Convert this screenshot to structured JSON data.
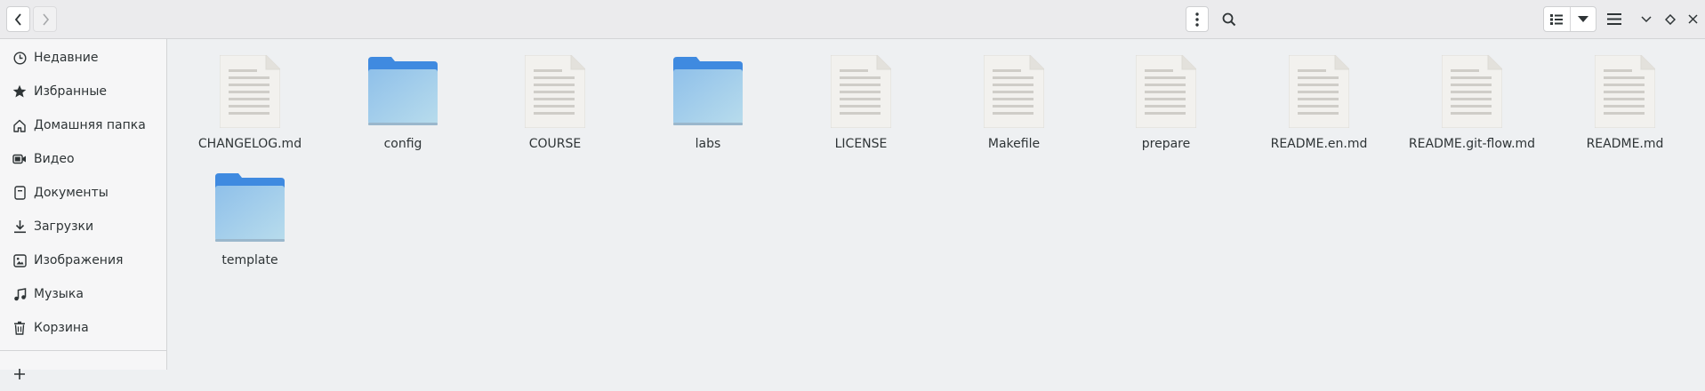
{
  "header": {
    "back_icon": "chevron-left-icon",
    "forward_icon": "chevron-right-icon",
    "menu_icon": "vertical-dots-icon",
    "search_icon": "search-icon",
    "view_icon": "list-view-icon",
    "view_dropdown_icon": "triangle-down-icon",
    "main_menu_icon": "hamburger-icon",
    "window_controls": [
      "minimize-icon",
      "maximize-icon",
      "close-icon"
    ]
  },
  "sidebar": {
    "items": [
      {
        "label": "Недавние",
        "icon": "clock-icon"
      },
      {
        "label": "Избранные",
        "icon": "star-icon"
      },
      {
        "label": "Домашняя папка",
        "icon": "home-icon"
      },
      {
        "label": "Видео",
        "icon": "video-icon"
      },
      {
        "label": "Документы",
        "icon": "document-icon"
      },
      {
        "label": "Загрузки",
        "icon": "download-icon"
      },
      {
        "label": "Изображения",
        "icon": "image-icon"
      },
      {
        "label": "Музыка",
        "icon": "music-icon"
      },
      {
        "label": "Корзина",
        "icon": "trash-icon"
      }
    ],
    "partial_item_icon": "plus-icon"
  },
  "files": [
    {
      "name": "CHANGELOG.md",
      "type": "file"
    },
    {
      "name": "config",
      "type": "folder"
    },
    {
      "name": "COURSE",
      "type": "file"
    },
    {
      "name": "labs",
      "type": "folder"
    },
    {
      "name": "LICENSE",
      "type": "file"
    },
    {
      "name": "Makefile",
      "type": "file"
    },
    {
      "name": "prepare",
      "type": "file"
    },
    {
      "name": "README.en.md",
      "type": "file"
    },
    {
      "name": "README.git-flow.md",
      "type": "file"
    },
    {
      "name": "README.md",
      "type": "file"
    },
    {
      "name": "template",
      "type": "folder"
    }
  ],
  "colors": {
    "folder_top": "#3f8ae0",
    "folder_body_light": "#b8dcec",
    "folder_body_dark": "#8fc0ea",
    "file_bg": "#f2f1ee",
    "file_lines": "#cfcdc8"
  }
}
